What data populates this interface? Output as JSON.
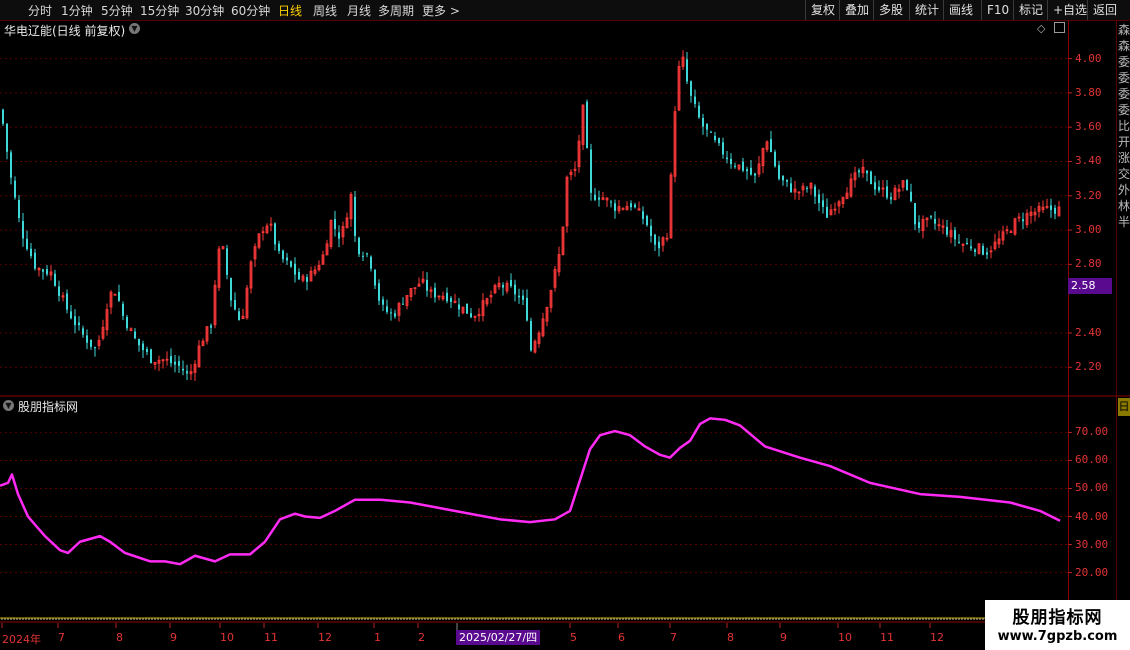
{
  "toolbar": {
    "periods": [
      "分时",
      "1分钟",
      "5分钟",
      "15分钟",
      "30分钟",
      "60分钟",
      "日线",
      "周线",
      "月线",
      "多周期",
      "更多 >"
    ],
    "active_period": "日线",
    "right_buttons": [
      "复权",
      "叠加",
      "多股",
      "统计",
      "画线",
      "F10",
      "标记",
      "+自选",
      "返回"
    ]
  },
  "stock_title": "华电辽能(日线 前复权)",
  "indicator_title": "股朋指标网",
  "price_tag": "2.58",
  "date_tag": "2025/02/27/四",
  "side_text": "森森委委委委比开涨交外林半",
  "indicator_side_tag": "日",
  "watermark": {
    "cn": "股朋指标网",
    "url": "www.7gpzb.com"
  },
  "colors": {
    "up": "#ff3a3a",
    "down": "#3ed8d8",
    "indicator": "#ff2bf5",
    "axis": "#e23434",
    "tag": "#5a0a8f"
  },
  "chart_data": [
    {
      "type": "candlestick",
      "y_ticks": [
        4.0,
        3.8,
        3.6,
        3.4,
        3.2,
        3.0,
        2.8,
        2.4,
        2.2
      ],
      "ylim": [
        2.05,
        4.12
      ],
      "current_price": 2.58,
      "close_path": [
        [
          0,
          3.7
        ],
        [
          10,
          3.3
        ],
        [
          20,
          3.0
        ],
        [
          35,
          2.78
        ],
        [
          50,
          2.75
        ],
        [
          65,
          2.55
        ],
        [
          80,
          2.4
        ],
        [
          95,
          2.3
        ],
        [
          100,
          2.4
        ],
        [
          108,
          2.62
        ],
        [
          115,
          2.65
        ],
        [
          122,
          2.5
        ],
        [
          135,
          2.35
        ],
        [
          150,
          2.25
        ],
        [
          165,
          2.24
        ],
        [
          180,
          2.2
        ],
        [
          188,
          2.14
        ],
        [
          200,
          2.35
        ],
        [
          210,
          2.45
        ],
        [
          215,
          2.75
        ],
        [
          220,
          2.95
        ],
        [
          230,
          2.6
        ],
        [
          240,
          2.45
        ],
        [
          250,
          2.8
        ],
        [
          260,
          3.0
        ],
        [
          268,
          3.05
        ],
        [
          278,
          2.85
        ],
        [
          290,
          2.78
        ],
        [
          300,
          2.7
        ],
        [
          312,
          2.75
        ],
        [
          322,
          2.85
        ],
        [
          330,
          3.05
        ],
        [
          340,
          2.95
        ],
        [
          350,
          3.2
        ],
        [
          355,
          2.9
        ],
        [
          368,
          2.85
        ],
        [
          380,
          2.55
        ],
        [
          392,
          2.5
        ],
        [
          405,
          2.62
        ],
        [
          420,
          2.7
        ],
        [
          430,
          2.63
        ],
        [
          445,
          2.62
        ],
        [
          460,
          2.55
        ],
        [
          472,
          2.5
        ],
        [
          485,
          2.58
        ],
        [
          498,
          2.68
        ],
        [
          512,
          2.65
        ],
        [
          525,
          2.55
        ],
        [
          530,
          2.3
        ],
        [
          540,
          2.45
        ],
        [
          552,
          2.7
        ],
        [
          560,
          2.9
        ],
        [
          566,
          3.3
        ],
        [
          574,
          3.35
        ],
        [
          582,
          3.7
        ],
        [
          590,
          3.2
        ],
        [
          600,
          3.2
        ],
        [
          615,
          3.13
        ],
        [
          630,
          3.15
        ],
        [
          645,
          3.05
        ],
        [
          655,
          2.88
        ],
        [
          668,
          3.0
        ],
        [
          672,
          3.6
        ],
        [
          680,
          4.05
        ],
        [
          688,
          3.8
        ],
        [
          700,
          3.62
        ],
        [
          715,
          3.5
        ],
        [
          730,
          3.4
        ],
        [
          745,
          3.35
        ],
        [
          755,
          3.3
        ],
        [
          765,
          3.55
        ],
        [
          778,
          3.3
        ],
        [
          795,
          3.22
        ],
        [
          810,
          3.25
        ],
        [
          825,
          3.08
        ],
        [
          840,
          3.2
        ],
        [
          860,
          3.35
        ],
        [
          875,
          3.25
        ],
        [
          890,
          3.2
        ],
        [
          905,
          3.28
        ],
        [
          915,
          3.02
        ],
        [
          930,
          3.05
        ],
        [
          945,
          3.0
        ],
        [
          960,
          2.92
        ],
        [
          975,
          2.9
        ],
        [
          985,
          2.87
        ],
        [
          1000,
          2.95
        ],
        [
          1015,
          3.05
        ],
        [
          1030,
          3.1
        ],
        [
          1045,
          3.12
        ],
        [
          1060,
          3.12
        ]
      ]
    },
    {
      "type": "line",
      "y_ticks": [
        70.0,
        60.0,
        50.0,
        40.0,
        30.0,
        20.0
      ],
      "ylim": [
        12,
        78
      ],
      "line": [
        [
          0,
          51
        ],
        [
          8,
          52
        ],
        [
          12,
          55
        ],
        [
          18,
          48
        ],
        [
          28,
          40
        ],
        [
          45,
          33
        ],
        [
          60,
          28
        ],
        [
          68,
          27
        ],
        [
          80,
          31
        ],
        [
          100,
          33
        ],
        [
          110,
          31
        ],
        [
          125,
          27
        ],
        [
          150,
          24
        ],
        [
          165,
          24
        ],
        [
          180,
          23
        ],
        [
          195,
          26
        ],
        [
          215,
          24
        ],
        [
          230,
          26.5
        ],
        [
          250,
          26.5
        ],
        [
          265,
          31
        ],
        [
          280,
          39
        ],
        [
          295,
          41
        ],
        [
          305,
          40
        ],
        [
          320,
          39.5
        ],
        [
          335,
          42
        ],
        [
          355,
          46
        ],
        [
          380,
          46
        ],
        [
          410,
          45
        ],
        [
          440,
          43
        ],
        [
          470,
          41
        ],
        [
          500,
          39
        ],
        [
          530,
          38
        ],
        [
          555,
          39
        ],
        [
          570,
          42
        ],
        [
          580,
          53
        ],
        [
          590,
          64
        ],
        [
          600,
          69
        ],
        [
          615,
          70.5
        ],
        [
          630,
          69
        ],
        [
          645,
          65
        ],
        [
          660,
          62
        ],
        [
          670,
          61
        ],
        [
          680,
          64.5
        ],
        [
          690,
          67
        ],
        [
          700,
          73
        ],
        [
          710,
          75
        ],
        [
          725,
          74.5
        ],
        [
          740,
          72.5
        ],
        [
          765,
          65
        ],
        [
          800,
          61
        ],
        [
          830,
          58
        ],
        [
          870,
          52
        ],
        [
          920,
          48
        ],
        [
          960,
          47
        ],
        [
          1010,
          45
        ],
        [
          1040,
          42
        ],
        [
          1060,
          38.5
        ]
      ]
    }
  ],
  "x_axis_labels": [
    "2024年",
    "7",
    "8",
    "9",
    "10",
    "11",
    "12",
    "1",
    "2",
    "5",
    "6",
    "7",
    "8",
    "9",
    "10",
    "11",
    "12"
  ]
}
